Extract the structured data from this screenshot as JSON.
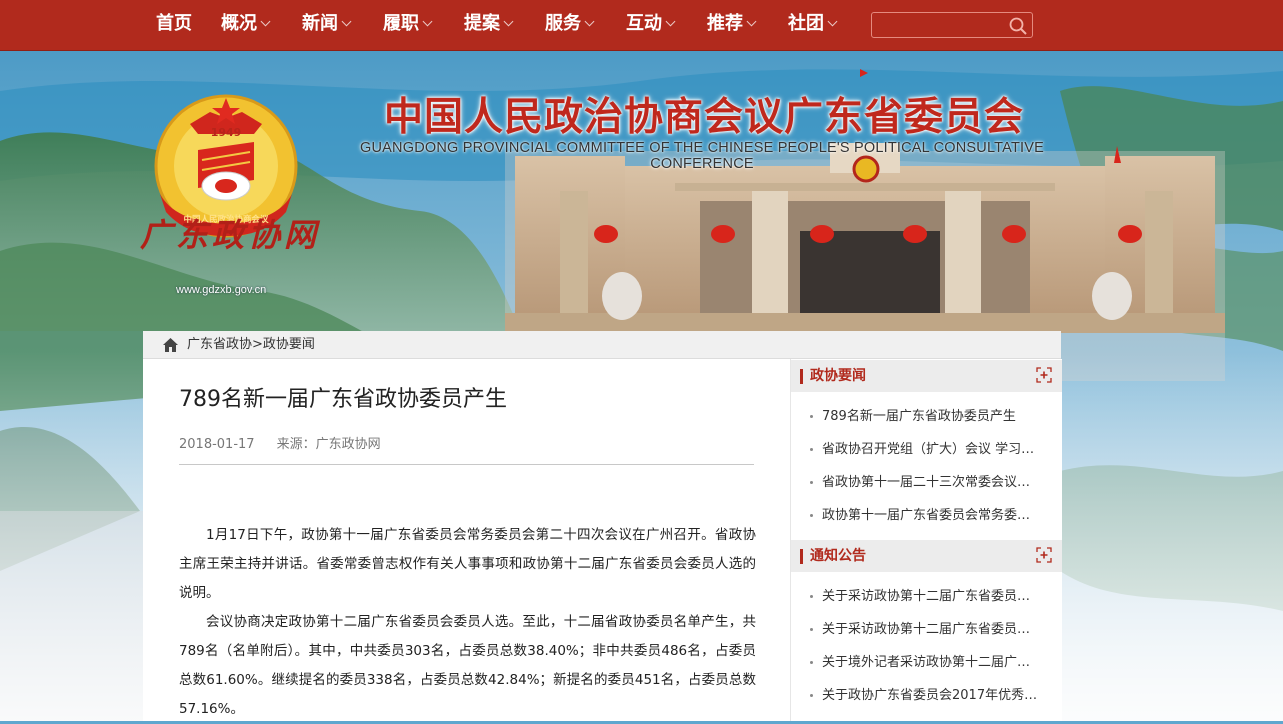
{
  "nav": {
    "items": [
      {
        "label": "首页",
        "dropdown": false
      },
      {
        "label": "概况",
        "dropdown": true
      },
      {
        "label": "新闻",
        "dropdown": true
      },
      {
        "label": "履职",
        "dropdown": true
      },
      {
        "label": "提案",
        "dropdown": true
      },
      {
        "label": "服务",
        "dropdown": true
      },
      {
        "label": "互动",
        "dropdown": true
      },
      {
        "label": "推荐",
        "dropdown": true
      },
      {
        "label": "社团",
        "dropdown": true
      }
    ],
    "search_value": "",
    "search_icon": "search-icon"
  },
  "banner": {
    "title_cn": "中国人民政治协商会议广东省委员会",
    "title_en": "GUANGDONG PROVINCIAL COMMITTEE OF THE CHINESE PEOPLE'S POLITICAL CONSULTATIVE CONFERENCE",
    "emblem_year": "1949",
    "emblem_ribbon": "中国人民政治协商会议",
    "logo_text": "广东政协网",
    "logo_url": "www.gdzxb.gov.cn"
  },
  "breadcrumb": {
    "home_icon": "home-icon",
    "items": [
      "广东省政协",
      "政协要闻"
    ],
    "separator": ">"
  },
  "article": {
    "title": "789名新一届广东省政协委员产生",
    "date": "2018-01-17",
    "source": "来源：广东政协网",
    "paragraphs": [
      "1月17日下午，政协第十一届广东省委员会常务委员会第二十四次会议在广州召开。省政协主席王荣主持并讲话。省委常委曾志权作有关人事事项和政协第十二届广东省委员会委员人选的说明。",
      "会议协商决定政协第十二届广东省委员会委员人选。至此，十二届省政协委员名单产生，共789名（名单附后）。其中，中共委员303名，占委员总数38.40%；非中共委员486名，占委员总数61.60%。继续提名的委员338名，占委员总数42.84%；新提名的委员451名，占委员总数57.16%。"
    ]
  },
  "sidebar": {
    "sections": [
      {
        "title": "政协要闻",
        "more_icon": "expand-plus-icon",
        "items": [
          "789名新一届广东省政协委员产生",
          "省政协召开党组（扩大）会议 学习…",
          "省政协第十一届二十三次常委会议…",
          "政协第十一届广东省委员会常务委…"
        ]
      },
      {
        "title": "通知公告",
        "more_icon": "expand-plus-icon",
        "items": [
          "关于采访政协第十二届广东省委员…",
          "关于采访政协第十二届广东省委员…",
          "关于境外记者采访政协第十二届广…",
          "关于政协广东省委员会2017年优秀…"
        ]
      }
    ]
  },
  "colors": {
    "brand_red": "#b12a1d",
    "nav_text": "#ffffff",
    "emblem_gold": "#f2c230"
  }
}
